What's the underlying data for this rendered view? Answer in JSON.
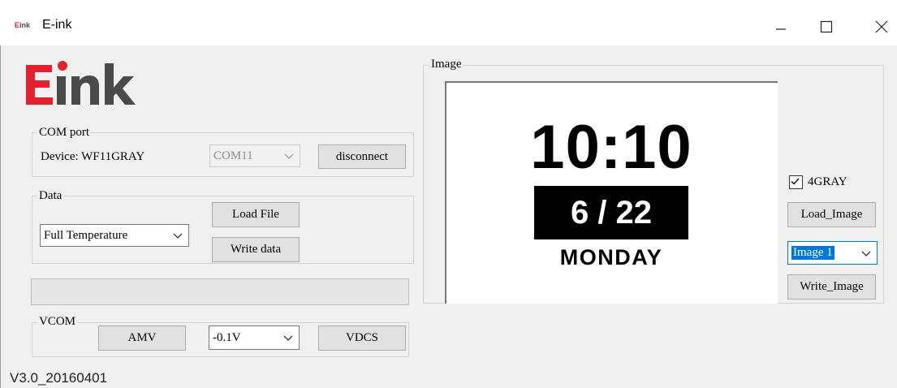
{
  "window": {
    "title": "E-ink",
    "icon_text": "Eink",
    "controls": [
      "minimize-icon",
      "maximize-icon",
      "close-icon"
    ]
  },
  "logo": {
    "text": "Eink",
    "colors": {
      "E": "#e4222e",
      "ink": "#4a4a4a",
      "dot": "#e4222e"
    }
  },
  "com_port": {
    "legend": "COM port",
    "device_label": "Device: WF11GRAY",
    "port_value": "COM11",
    "disconnect_label": "disconnect"
  },
  "data_group": {
    "legend": "Data",
    "mode_value": "Full Temperature",
    "load_file_label": "Load File",
    "write_data_label": "Write data"
  },
  "progress": {
    "value": 0
  },
  "vcom": {
    "legend": "VCOM",
    "amv_label": "AMV",
    "voltage_value": "-0.1V",
    "vdcs_label": "VDCS"
  },
  "image_group": {
    "legend": "Image",
    "preview": {
      "time": "10:10",
      "date": "6 / 22",
      "day": "MONDAY"
    },
    "gray_checkbox_label": "4GRAY",
    "gray_checked": true,
    "load_image_label": "Load_Image",
    "image_select_value": "Image 1",
    "write_image_label": "Write_Image"
  },
  "version": "V3.0_20160401",
  "colors": {
    "accent": "#0078d7",
    "window_bg": "#f0f0f0",
    "button_bg": "#e1e1e1"
  }
}
